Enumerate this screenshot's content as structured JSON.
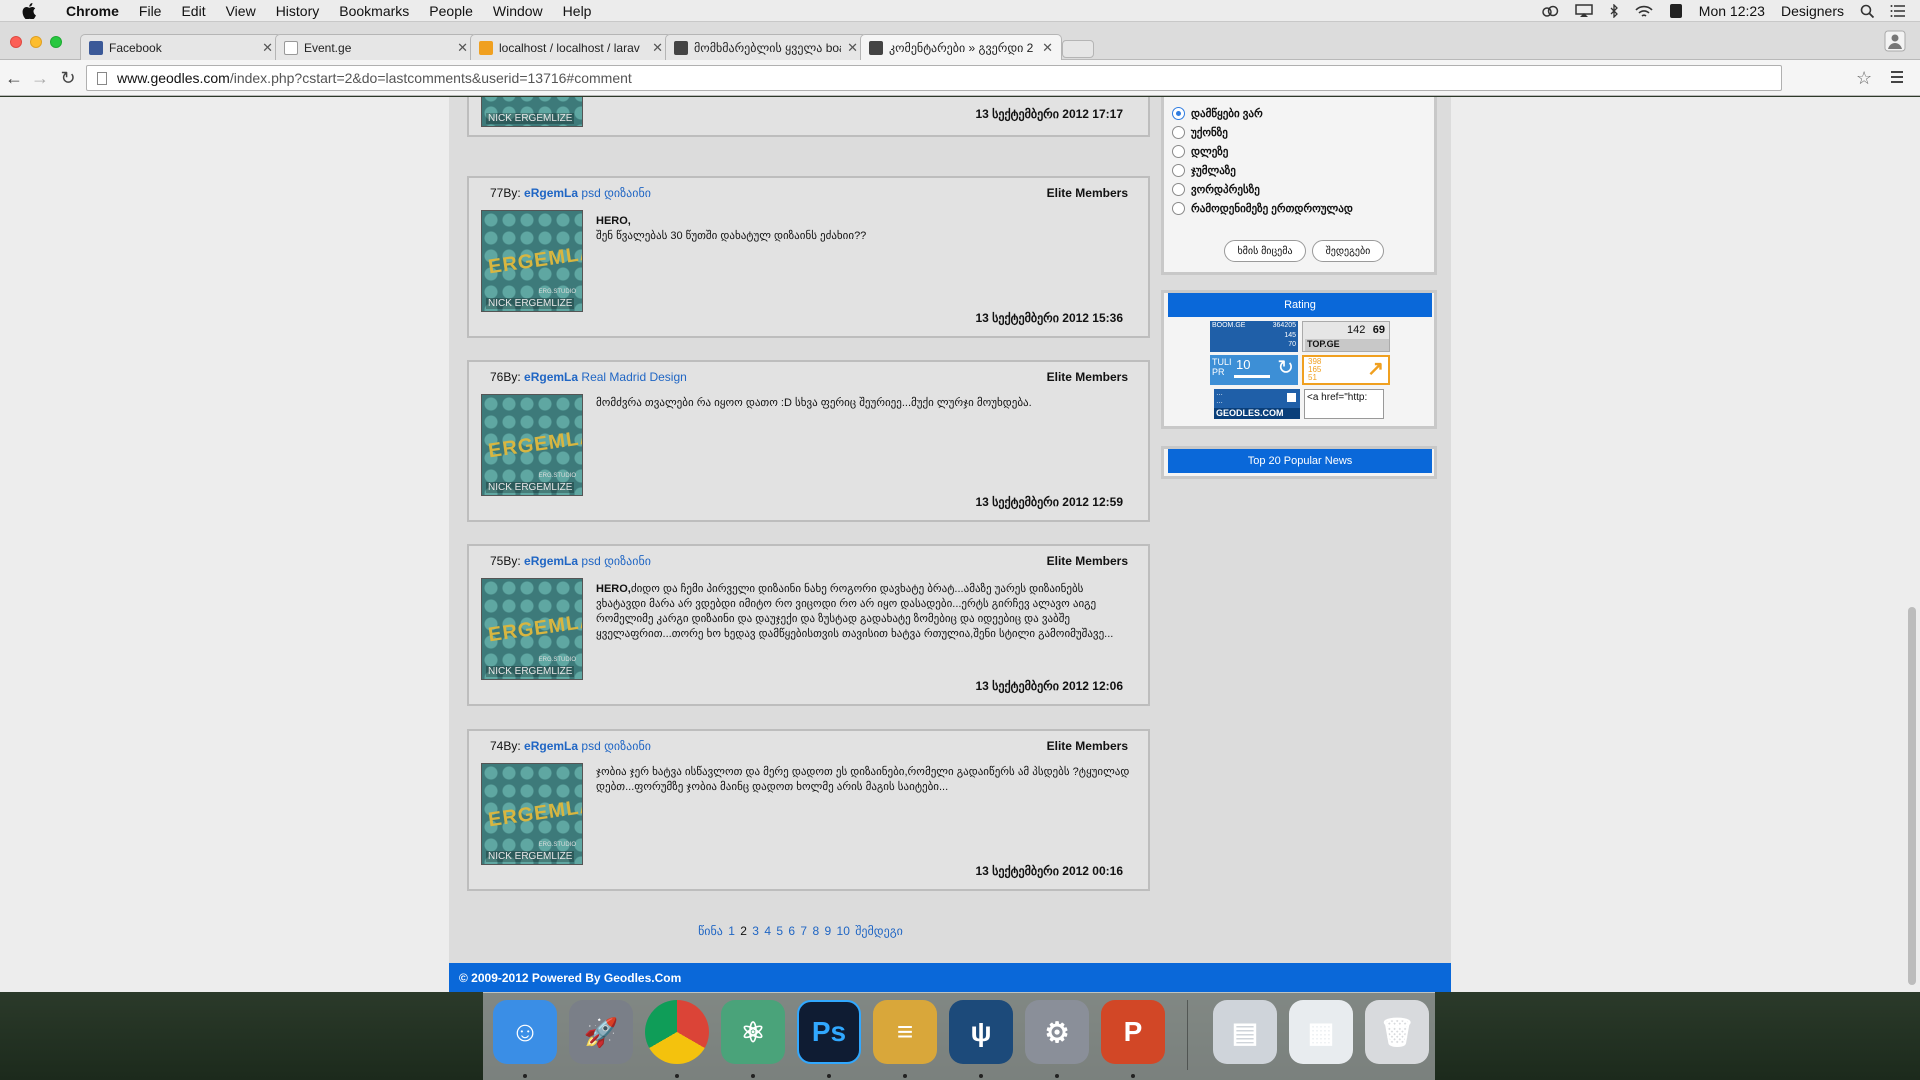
{
  "menubar": {
    "app": "Chrome",
    "items": [
      "File",
      "Edit",
      "View",
      "History",
      "Bookmarks",
      "People",
      "Window",
      "Help"
    ],
    "clock": "Mon 12:23",
    "user": "Designers"
  },
  "tabs": [
    {
      "title": "Facebook",
      "color": "#3b5998"
    },
    {
      "title": "Event.ge",
      "color": "#ffffff"
    },
    {
      "title": "localhost / localhost / larav",
      "color": "#f0a020"
    },
    {
      "title": "მომხმარებლის ყველა boa",
      "color": "#444444"
    },
    {
      "title": "კომენტარები » გვერდი 2",
      "color": "#444444",
      "active": true
    }
  ],
  "address": {
    "host": "www.geodles.com",
    "path": "/index.php?cstart=2&do=lastcomments&userid=13716#comment"
  },
  "comments": [
    {
      "num": "77",
      "by": "By:",
      "author": "eRgemLa",
      "topic": "psd დიზაინი",
      "role": "Elite Members",
      "body_bold": "HERO,",
      "body": "შენ წვალებას 30 წუთში დახატულ დიზაინს ეძახიი??",
      "date": "13 სექტემბერი 2012 15:36"
    },
    {
      "num": "76",
      "by": "By:",
      "author": "eRgemLa",
      "topic": "Real Madrid Design",
      "role": "Elite Members",
      "body_bold": "",
      "body": "მომძვრა თვალები რა იყოო დათო :D სხვა ფერიც შეურიეე...მუქი ლურჯი მოუხდება.",
      "date": "13 სექტემბერი 2012 12:59"
    },
    {
      "num": "75",
      "by": "By:",
      "author": "eRgemLa",
      "topic": "psd დიზაინი",
      "role": "Elite Members",
      "body_bold": "HERO,",
      "body": "ძიდო და ჩემი პირველი დიზაინი ნახე როგორი დავხატე ბრატ...ამაზე უარეს დიზაინებს ვხატავდი მარა არ ვდებდი იმიტო რო ვიცოდი რო არ იყო დასადები...ერტს გირჩევ ალავო აიგე რომელიმე კარგი დიზაინი და დაუჯექი და ზუსტად გადახატე ზომებიც და იდეებიც და ვაბშე ყველაფრით...თორე ხო ხედავ დამწყებისთვის თავისით ხატვა რთულია,შენი სტილი გამოიმუშავე...",
      "date": "13 სექტემბერი 2012 12:06"
    },
    {
      "num": "74",
      "by": "By:",
      "author": "eRgemLa",
      "topic": "psd დიზაინი",
      "role": "Elite Members",
      "body_bold": "",
      "body": "ჯობია ჯერ ხატვა ისწავლოთ და მერე დადოთ ეს დიზაინები,რომელი გადაიწერს ამ პსდებს ?ტყუილად დებთ...ფორუმზე ჯობია მაინც დადოთ ხოლმე არის მაგის საიტები...",
      "date": "13 სექტემბერი 2012 00:16"
    }
  ],
  "top_comment_date": "13 სექტემბერი 2012 17:17",
  "avatar": {
    "brand": "ERGEMLA",
    "name": "NICK ERGEMLIZE",
    "studio": "ERG.STUDIO"
  },
  "pager": {
    "prev": "წინა",
    "pages": [
      "1",
      "2",
      "3",
      "4",
      "5",
      "6",
      "7",
      "8",
      "9",
      "10"
    ],
    "current": "2",
    "next": "შემდეგი"
  },
  "poll": {
    "options": [
      "დამწყები ვარ",
      "უქონზე",
      "დლეზე",
      "ჯუმლაზე",
      "ვორდპრესზე",
      "რამოდენიმეზე ერთდროულად"
    ],
    "selected": 0,
    "vote_label": "ხმის მიცემა",
    "results_label": "შედეგები"
  },
  "rating": {
    "title": "Rating",
    "boom": {
      "name": "BOOM.GE",
      "n1": "364205",
      "n2": "145",
      "n3": "70"
    },
    "topge": {
      "n1": "142",
      "n2": "69",
      "name": "TOP.GE"
    },
    "tulpr": {
      "name": "TULI PR",
      "value": "10"
    },
    "counter": {
      "a": "398",
      "b": "165",
      "c": "51"
    },
    "geodles_badge": {
      "line1": "…",
      "line2": "…",
      "name": "GEODLES.COM"
    },
    "code_snippet": "<a href=\"http:"
  },
  "popular": {
    "title": "Top 20 Popular News"
  },
  "footer": "© 2009-2012 Powered By Geodles.Com",
  "dock": {
    "apps": [
      {
        "name": "Finder",
        "color": "#3a8ee6",
        "label": "☺"
      },
      {
        "name": "Launchpad",
        "color": "#7a7f88",
        "label": "🚀"
      },
      {
        "name": "Chrome",
        "color": "#e8e8e8",
        "label": ""
      },
      {
        "name": "Atom",
        "color": "#4aa37a",
        "label": "⚛"
      },
      {
        "name": "Photoshop",
        "color": "#0f1c33",
        "label": "Ps"
      },
      {
        "name": "Sequel Pro",
        "color": "#d9a73a",
        "label": "≡"
      },
      {
        "name": "SourceTree",
        "color": "#1c4a7a",
        "label": "ψ"
      },
      {
        "name": "System Preferences",
        "color": "#8a8f99",
        "label": "⚙"
      },
      {
        "name": "PowerPoint",
        "color": "#d24726",
        "label": "P"
      },
      {
        "name": "Archive",
        "color": "#cfd4da",
        "label": "▤"
      },
      {
        "name": "Preview",
        "color": "#e8ecef",
        "label": "▦"
      },
      {
        "name": "Trash",
        "color": "#d8dadd",
        "label": "🗑"
      }
    ]
  }
}
